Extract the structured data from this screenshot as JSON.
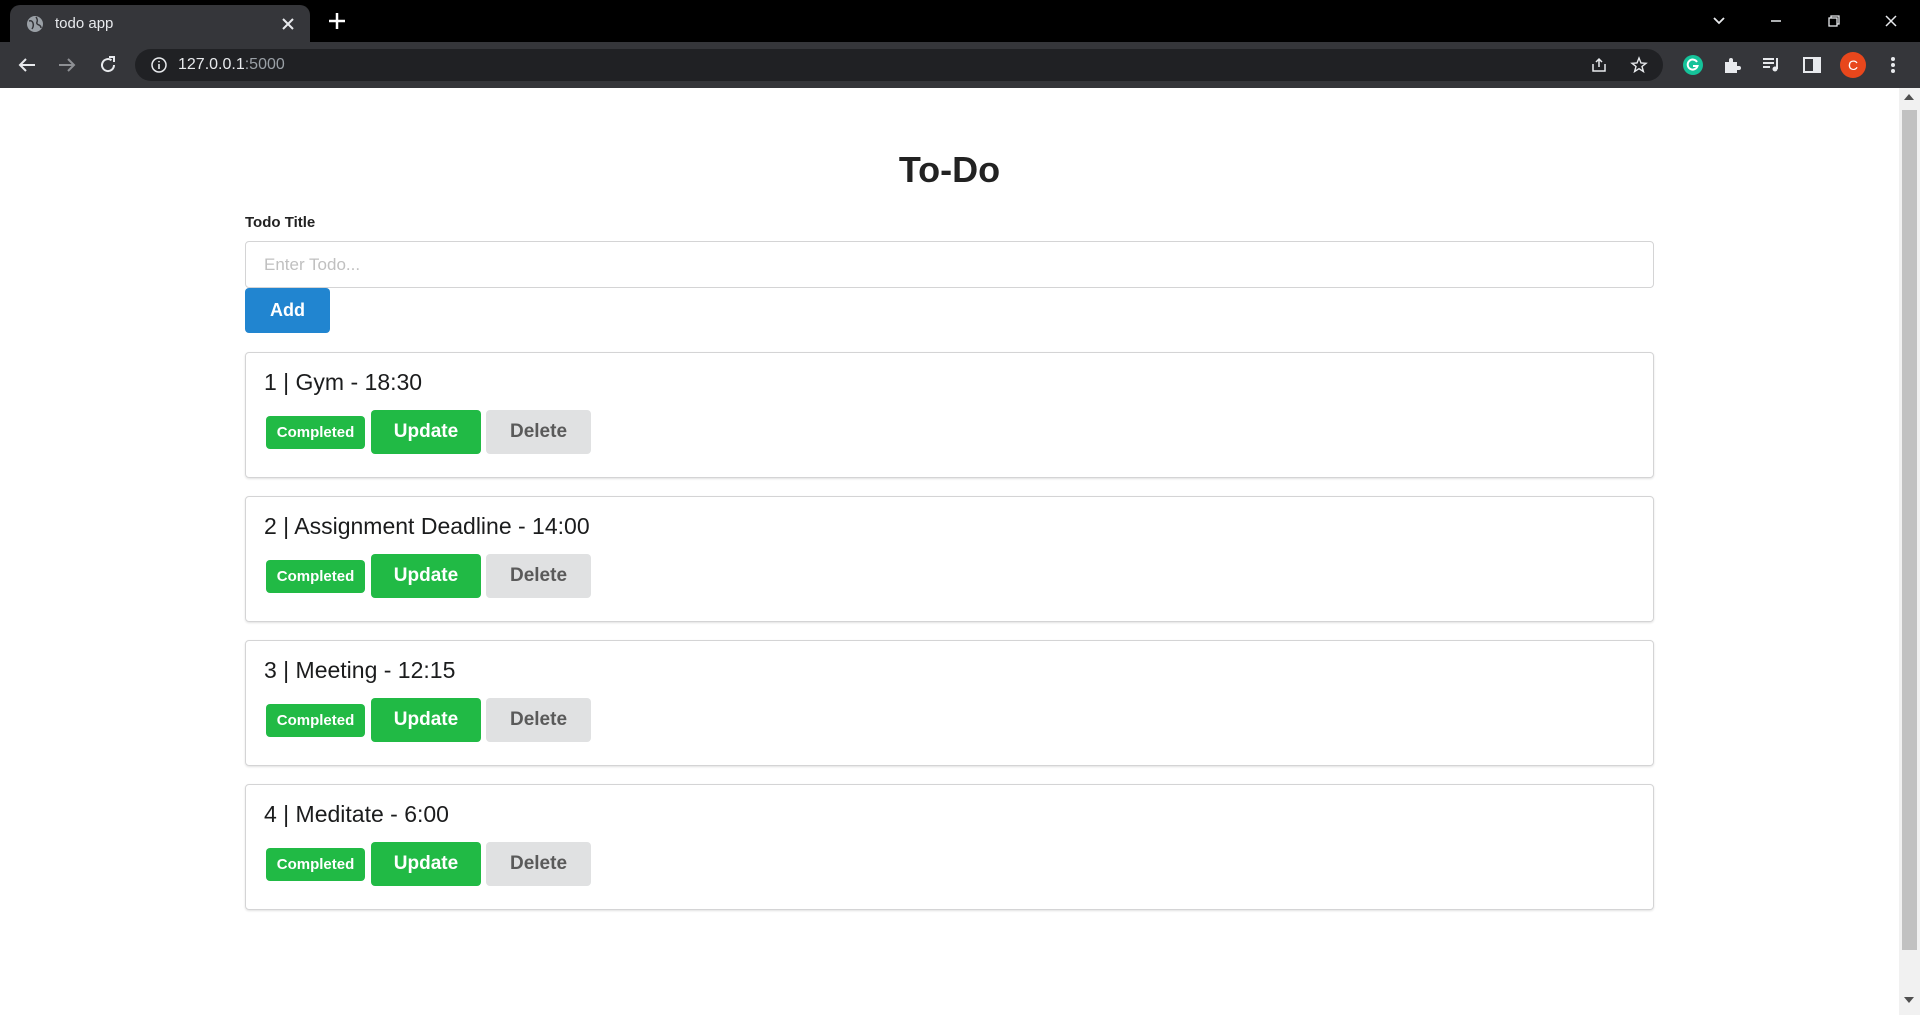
{
  "browser": {
    "tab_title": "todo app",
    "url_host": "127.0.0.1",
    "url_port": ":5000",
    "profile_initial": "C"
  },
  "page": {
    "heading": "To-Do",
    "field_label": "Todo Title",
    "input_placeholder": "Enter Todo...",
    "input_value": "",
    "add_label": "Add"
  },
  "todos": [
    {
      "text": "1 | Gym - 18:30",
      "status": "Completed",
      "update_label": "Update",
      "delete_label": "Delete"
    },
    {
      "text": "2 | Assignment Deadline - 14:00",
      "status": "Completed",
      "update_label": "Update",
      "delete_label": "Delete"
    },
    {
      "text": "3 | Meeting - 12:15",
      "status": "Completed",
      "update_label": "Update",
      "delete_label": "Delete"
    },
    {
      "text": "4 | Meditate - 6:00",
      "status": "Completed",
      "update_label": "Update",
      "delete_label": "Delete"
    }
  ],
  "colors": {
    "primary": "#2185d0",
    "success": "#21ba45",
    "neutral": "#e0e1e2"
  }
}
